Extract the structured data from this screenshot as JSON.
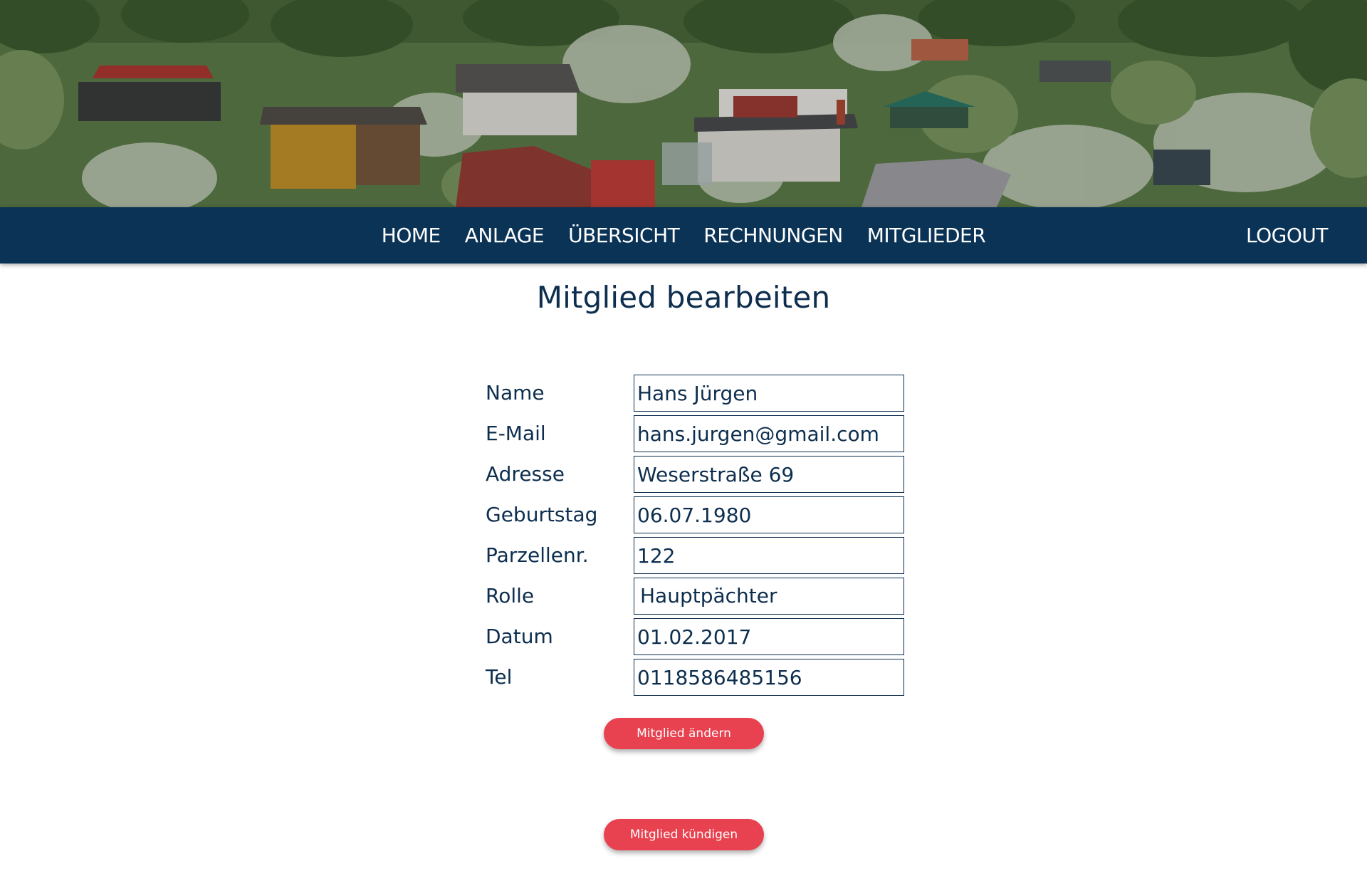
{
  "hero": {
    "image": "allotment-garden-colony-photo"
  },
  "nav": {
    "items": [
      {
        "label": "HOME"
      },
      {
        "label": "ANLAGE"
      },
      {
        "label": "ÜBERSICHT"
      },
      {
        "label": "RECHNUNGEN"
      },
      {
        "label": "MITGLIEDER"
      }
    ],
    "logout_label": "LOGOUT",
    "background_color": "#0b3356"
  },
  "main": {
    "title": "Mitglied bearbeiten",
    "fields": [
      {
        "label": "Name",
        "value": "Hans Jürgen"
      },
      {
        "label": "E-Mail",
        "value": "hans.jurgen@gmail.com"
      },
      {
        "label": "Adresse",
        "value": "Weserstraße 69"
      },
      {
        "label": "Geburtstag",
        "value": "06.07.1980"
      },
      {
        "label": "Parzellenr.",
        "value": "122"
      },
      {
        "label": "Rolle",
        "value": "Hauptpächter"
      },
      {
        "label": "Datum",
        "value": "01.02.2017"
      },
      {
        "label": "Tel",
        "value": "0118586485156"
      }
    ],
    "update_button": "Mitglied ändern",
    "cancel_button": "Mitglied kündigen",
    "accent_color": "#e8414f",
    "text_color": "#0d2e4e"
  }
}
